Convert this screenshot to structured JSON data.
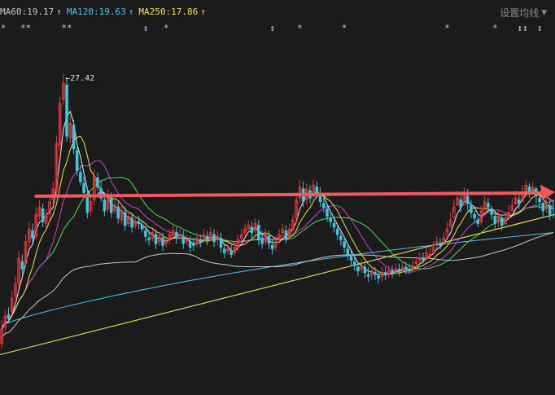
{
  "legend": {
    "ma60": {
      "label": "MA60:19.17",
      "arrow": "↑",
      "color": "#c9c9c9"
    },
    "ma120": {
      "label": "MA120:19.63",
      "arrow": "↑",
      "color": "#4fc3f7"
    },
    "ma250": {
      "label": "MA250:17.86",
      "arrow": "↑",
      "color": "#f0e25a"
    }
  },
  "settings": {
    "label": "设置均线",
    "icon": "chevron-down-icon"
  },
  "event_marks": [
    {
      "glyph": "*",
      "index": 0
    },
    {
      "glyph": "**",
      "index": 7
    },
    {
      "glyph": "**",
      "index": 19
    },
    {
      "glyph": "↕",
      "index": 42
    },
    {
      "glyph": "*",
      "index": 48
    },
    {
      "glyph": "↕",
      "index": 79
    },
    {
      "glyph": "*",
      "index": 87
    },
    {
      "glyph": "*",
      "index": 100
    },
    {
      "glyph": "*",
      "index": 130
    },
    {
      "glyph": "*",
      "index": 144
    },
    {
      "glyph": "↕↕",
      "index": 152
    },
    {
      "glyph": "↕",
      "index": 157
    }
  ],
  "colors": {
    "background": "#1b1b1b",
    "up": "#e5383b",
    "down": "#3ec6e0",
    "arrow": "#f05a5a",
    "ma5": "#f2f2f2",
    "ma10": "#f7e14a",
    "ma20": "#d040d6",
    "ma30": "#4be04b",
    "ma60": "#c9c9c9",
    "ma120": "#4fc3f7",
    "ma250": "#f0e25a"
  },
  "chart_data": {
    "type": "candlestick",
    "max_label": "27.42",
    "max_index": 19,
    "price_range": [
      11.8,
      29.5
    ],
    "trend_arrow": {
      "from_index": 10,
      "to_index": 161,
      "price": 20.7
    },
    "ma250_endpoints": [
      12.0,
      19.7
    ],
    "ma120_endpoints": [
      13.6,
      18.7
    ],
    "ma60_endpoints": [
      12.4,
      17.6
    ],
    "close": [
      13.4,
      14.1,
      14.0,
      15.1,
      15.9,
      17.3,
      16.7,
      18.2,
      18.9,
      18.4,
      19.7,
      20.1,
      19.3,
      19.6,
      20.4,
      21.1,
      23.6,
      25.8,
      26.9,
      24.0,
      24.7,
      23.3,
      22.1,
      21.5,
      20.9,
      19.8,
      20.4,
      21.8,
      21.2,
      20.6,
      19.9,
      20.7,
      19.8,
      20.2,
      19.5,
      19.9,
      19.1,
      19.6,
      19.0,
      19.3,
      19.2,
      18.9,
      18.5,
      18.3,
      18.7,
      18.1,
      18.5,
      18.0,
      18.2,
      18.6,
      18.8,
      18.4,
      18.6,
      18.1,
      18.3,
      17.9,
      18.0,
      18.4,
      18.2,
      18.6,
      18.3,
      18.7,
      18.2,
      18.5,
      17.9,
      17.6,
      17.8,
      17.5,
      17.9,
      18.3,
      18.6,
      18.9,
      19.1,
      18.7,
      19.2,
      18.3,
      18.1,
      18.6,
      18.1,
      17.8,
      18.2,
      18.6,
      18.9,
      18.4,
      18.9,
      19.4,
      20.5,
      21.2,
      20.4,
      21.1,
      20.6,
      21.3,
      20.9,
      20.4,
      20.1,
      19.6,
      19.3,
      19.0,
      18.6,
      18.3,
      17.9,
      17.5,
      17.2,
      16.9,
      16.6,
      16.9,
      16.5,
      16.3,
      16.6,
      16.4,
      16.2,
      16.5,
      16.4,
      16.6,
      16.5,
      16.7,
      16.6,
      16.8,
      16.7,
      16.6,
      16.9,
      17.1,
      17.3,
      17.2,
      17.6,
      17.5,
      17.9,
      18.2,
      18.0,
      18.4,
      18.9,
      19.4,
      20.1,
      20.6,
      20.1,
      20.8,
      20.3,
      19.8,
      19.5,
      19.2,
      19.9,
      20.4,
      20.1,
      19.7,
      19.2,
      19.6,
      19.1,
      19.4,
      19.8,
      20.2,
      20.6,
      20.3,
      20.9,
      21.3,
      20.8,
      21.2,
      20.7,
      20.4,
      19.9,
      20.3,
      19.7,
      20.2
    ],
    "open": [
      12.6,
      13.5,
      14.2,
      14.4,
      15.2,
      15.9,
      17.1,
      17.0,
      18.2,
      18.8,
      18.5,
      19.6,
      20.0,
      19.2,
      19.7,
      20.5,
      21.0,
      23.5,
      26.0,
      26.8,
      23.9,
      24.6,
      23.2,
      22.0,
      21.4,
      20.8,
      19.9,
      20.5,
      21.7,
      21.1,
      20.5,
      20.0,
      20.6,
      19.9,
      20.1,
      19.4,
      19.8,
      19.2,
      19.5,
      19.1,
      19.3,
      19.1,
      18.8,
      18.4,
      18.4,
      18.6,
      18.2,
      18.4,
      18.1,
      18.3,
      18.5,
      18.7,
      18.5,
      18.5,
      18.2,
      18.2,
      18.1,
      18.1,
      18.3,
      18.3,
      18.5,
      18.4,
      18.6,
      18.3,
      18.4,
      17.8,
      17.7,
      17.7,
      17.6,
      17.9,
      18.4,
      18.7,
      18.9,
      19.0,
      18.8,
      19.1,
      18.4,
      18.2,
      18.5,
      18.0,
      17.9,
      18.3,
      18.7,
      18.8,
      18.5,
      18.9,
      19.5,
      20.6,
      21.1,
      20.5,
      21.0,
      20.7,
      21.2,
      20.8,
      20.3,
      20.0,
      19.5,
      19.2,
      18.9,
      18.5,
      18.2,
      17.8,
      17.4,
      17.1,
      16.8,
      16.7,
      16.8,
      16.4,
      16.4,
      16.5,
      16.3,
      16.3,
      16.5,
      16.4,
      16.6,
      16.6,
      16.7,
      16.7,
      16.8,
      16.7,
      16.7,
      17.0,
      17.2,
      17.3,
      17.3,
      17.5,
      17.6,
      18.0,
      18.1,
      18.1,
      18.5,
      19.0,
      19.5,
      20.2,
      20.5,
      20.2,
      20.7,
      20.2,
      19.7,
      19.4,
      19.3,
      19.8,
      20.3,
      20.0,
      19.6,
      19.3,
      19.5,
      19.2,
      19.5,
      19.9,
      20.3,
      20.5,
      20.4,
      21.0,
      21.2,
      20.9,
      21.1,
      20.6,
      20.3,
      20.0,
      20.2
    ],
    "high": [
      13.9,
      14.5,
      14.6,
      15.5,
      16.3,
      17.7,
      17.5,
      18.6,
      19.3,
      19.2,
      20.1,
      20.5,
      20.3,
      20.0,
      20.8,
      21.5,
      24.0,
      26.2,
      27.42,
      27.1,
      25.1,
      24.9,
      23.6,
      22.4,
      21.8,
      21.2,
      20.8,
      22.2,
      22.0,
      21.5,
      20.9,
      21.1,
      20.9,
      20.5,
      20.4,
      20.3,
      20.1,
      19.9,
      19.8,
      19.6,
      19.6,
      19.4,
      19.1,
      18.8,
      18.9,
      18.9,
      18.7,
      18.7,
      18.5,
      18.9,
      19.1,
      19.0,
      18.9,
      18.8,
      18.6,
      18.5,
      18.4,
      18.7,
      18.6,
      18.9,
      18.8,
      19.0,
      18.9,
      18.8,
      18.7,
      18.1,
      18.1,
      18.0,
      18.2,
      18.6,
      18.9,
      19.2,
      19.4,
      19.3,
      19.5,
      19.4,
      18.8,
      18.9,
      18.8,
      18.3,
      18.5,
      18.9,
      19.2,
      19.1,
      19.2,
      19.7,
      20.9,
      21.6,
      21.5,
      21.4,
      21.3,
      21.6,
      21.5,
      21.2,
      20.6,
      20.3,
      19.9,
      19.5,
      19.2,
      18.8,
      18.5,
      18.1,
      17.7,
      17.4,
      17.1,
      17.2,
      17.1,
      16.8,
      16.9,
      16.8,
      16.6,
      16.8,
      16.8,
      16.9,
      16.9,
      17.0,
      17.0,
      17.1,
      17.1,
      17.0,
      17.2,
      17.4,
      17.6,
      17.6,
      17.9,
      17.9,
      18.2,
      18.5,
      18.4,
      18.7,
      19.3,
      19.8,
      20.5,
      21.0,
      20.9,
      21.2,
      21.1,
      20.5,
      19.9,
      19.6,
      20.2,
      20.7,
      20.6,
      20.2,
      19.8,
      19.9,
      19.7,
      19.8,
      20.2,
      20.6,
      21.0,
      20.9,
      21.3,
      21.6,
      21.4,
      21.5,
      21.2,
      20.8,
      20.4,
      20.6,
      20.5,
      20.5
    ],
    "low": [
      12.3,
      13.2,
      13.7,
      14.2,
      15.0,
      15.7,
      16.4,
      16.8,
      17.9,
      18.1,
      18.3,
      19.4,
      19.0,
      18.9,
      19.4,
      20.2,
      20.8,
      23.2,
      25.7,
      23.7,
      23.6,
      23.0,
      21.8,
      21.3,
      20.6,
      19.5,
      19.6,
      20.2,
      21.0,
      20.4,
      19.6,
      19.8,
      19.5,
      19.7,
      19.2,
      19.2,
      18.8,
      19.0,
      18.7,
      18.9,
      18.9,
      18.7,
      18.2,
      18.0,
      18.2,
      17.8,
      18.0,
      17.7,
      17.9,
      18.1,
      18.3,
      18.1,
      18.3,
      17.8,
      18.0,
      17.6,
      17.7,
      17.9,
      17.9,
      18.1,
      18.0,
      18.2,
      17.9,
      18.0,
      17.6,
      17.3,
      17.5,
      17.3,
      17.4,
      17.7,
      18.2,
      18.5,
      18.7,
      18.4,
      18.6,
      18.0,
      17.8,
      18.0,
      17.8,
      17.5,
      17.7,
      18.1,
      18.5,
      18.1,
      18.3,
      18.7,
      19.2,
      20.3,
      20.1,
      20.2,
      20.3,
      20.5,
      20.6,
      20.1,
      19.8,
      19.3,
      19.0,
      18.7,
      18.3,
      18.0,
      17.6,
      17.2,
      16.9,
      16.6,
      16.3,
      16.5,
      16.2,
      16.0,
      16.1,
      16.1,
      15.9,
      16.0,
      16.1,
      16.2,
      16.2,
      16.4,
      16.3,
      16.5,
      16.4,
      16.4,
      16.5,
      16.8,
      17.0,
      17.0,
      17.2,
      17.3,
      17.7,
      17.9,
      17.8,
      18.2,
      18.7,
      19.1,
      19.8,
      20.2,
      19.8,
      20.4,
      19.9,
      19.5,
      19.2,
      19.0,
      19.1,
      20.0,
      19.8,
      19.4,
      18.9,
      19.0,
      18.8,
      19.1,
      19.5,
      19.9,
      20.2,
      20.0,
      20.6,
      21.0,
      20.6,
      20.8,
      20.3,
      20.0,
      19.6,
      19.8,
      19.4,
      19.5
    ]
  }
}
